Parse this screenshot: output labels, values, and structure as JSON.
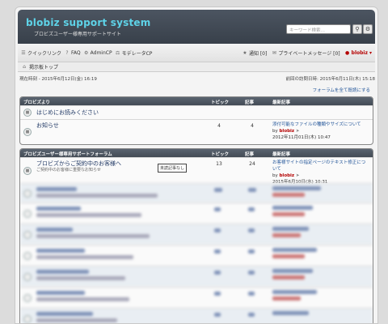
{
  "header": {
    "site_title": "blobiz support system",
    "site_description": "ブロビズユーザー様専用サポートサイト",
    "search_placeholder": "キーワード検索…",
    "search_icon": "magnifier-icon",
    "advanced_icon": "gear-icon"
  },
  "nav": {
    "quicklinks": "クイックリンク",
    "faq": "FAQ",
    "admin_cp": "AdminCP",
    "mod_cp": "モデレータCP",
    "notifications": "通知 [0]",
    "pm": "プライベートメッセージ [0]",
    "user": "blobiz"
  },
  "breadcrumb": {
    "home": "掲示板トップ"
  },
  "times": {
    "current": "現在時刻 - 2015年6月12日(金) 16:19",
    "last_visit": "前回の訪問日時: 2015年6月11日(木) 15:18"
  },
  "mark_read": "フォーラムを全て既読にする",
  "cat1": {
    "name": "ブロビズより",
    "col_topics": "トピック",
    "col_posts": "記事",
    "col_last": "最新記事",
    "forums": [
      {
        "title": "はじめにお読みください",
        "topics": "",
        "posts": "",
        "last_title": "",
        "last_by": "",
        "last_author": "",
        "last_date": ""
      },
      {
        "title": "お知らせ",
        "topics": "4",
        "posts": "4",
        "last_title": "添付可能なファイルの種類やサイズについて",
        "last_by": "by",
        "last_author": "blobiz",
        "last_date": "2012年11月01日(木) 10:47"
      }
    ]
  },
  "cat2": {
    "name": "ブロビズユーザー様専用サポートフォーラム",
    "col_topics": "トピック",
    "col_posts": "記事",
    "col_last": "最新記事",
    "forums": [
      {
        "title": "ブロビズからご契約中のお客様へ",
        "sub": "ご契約中のお客様に重要なお知らせ",
        "topics": "13",
        "posts": "24",
        "last_title": "お客様サイトの指定ページのテキスト修正について",
        "last_by": "by",
        "last_author": "blobiz",
        "last_date": "2015年6月10日(水) 10:31"
      }
    ]
  },
  "tooltip": "未読記事なし"
}
